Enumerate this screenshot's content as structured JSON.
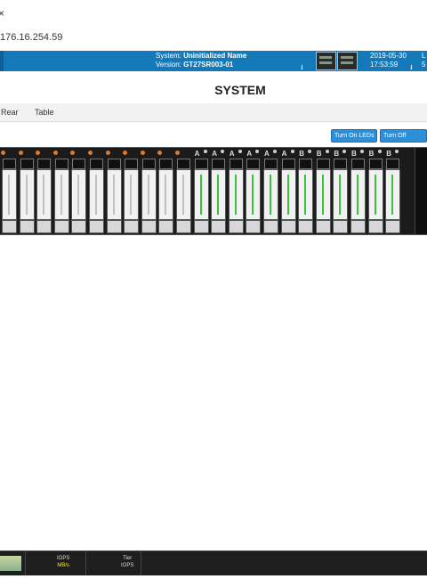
{
  "browser": {
    "address": "176.16.254.59"
  },
  "header": {
    "system_label": "System:",
    "system_value": "Uninitialized Name",
    "version_label": "Version:",
    "version_value": "GT27SR003-01",
    "date": "2019-05-30",
    "time": "17:53:59",
    "user_fragment": "L",
    "user_fragment2": "5"
  },
  "page": {
    "title": "SYSTEM"
  },
  "tabs": [
    {
      "label": "Rear"
    },
    {
      "label": "Table"
    }
  ],
  "buttons": {
    "turn_on_leds": "Turn On LEDs",
    "turn_off_leds": "Turn Off LEDS"
  },
  "slots": [
    {
      "label": "",
      "color": "orange",
      "green": false
    },
    {
      "label": "",
      "color": "orange",
      "green": false
    },
    {
      "label": "",
      "color": "orange",
      "green": false
    },
    {
      "label": "",
      "color": "orange",
      "green": false
    },
    {
      "label": "",
      "color": "orange",
      "green": false
    },
    {
      "label": "",
      "color": "orange",
      "green": false
    },
    {
      "label": "",
      "color": "orange",
      "green": false
    },
    {
      "label": "",
      "color": "orange",
      "green": false
    },
    {
      "label": "",
      "color": "orange",
      "green": false
    },
    {
      "label": "",
      "color": "orange",
      "green": false
    },
    {
      "label": "",
      "color": "orange",
      "green": false
    },
    {
      "label": "A",
      "color": "grey",
      "green": true
    },
    {
      "label": "A",
      "color": "grey",
      "green": true
    },
    {
      "label": "A",
      "color": "grey",
      "green": true
    },
    {
      "label": "A",
      "color": "grey",
      "green": true
    },
    {
      "label": "A",
      "color": "grey",
      "green": true
    },
    {
      "label": "A",
      "color": "grey",
      "green": true
    },
    {
      "label": "B",
      "color": "grey",
      "green": true
    },
    {
      "label": "B",
      "color": "grey",
      "green": true
    },
    {
      "label": "B",
      "color": "grey",
      "green": true
    },
    {
      "label": "B",
      "color": "grey",
      "green": true
    },
    {
      "label": "B",
      "color": "grey",
      "green": true
    },
    {
      "label": "B",
      "color": "grey",
      "green": true
    }
  ],
  "footer": {
    "group1_line1": "IOPS",
    "group1_line2": "MB/s",
    "group2_line1": "Tier",
    "group2_line2": "IOPS"
  }
}
